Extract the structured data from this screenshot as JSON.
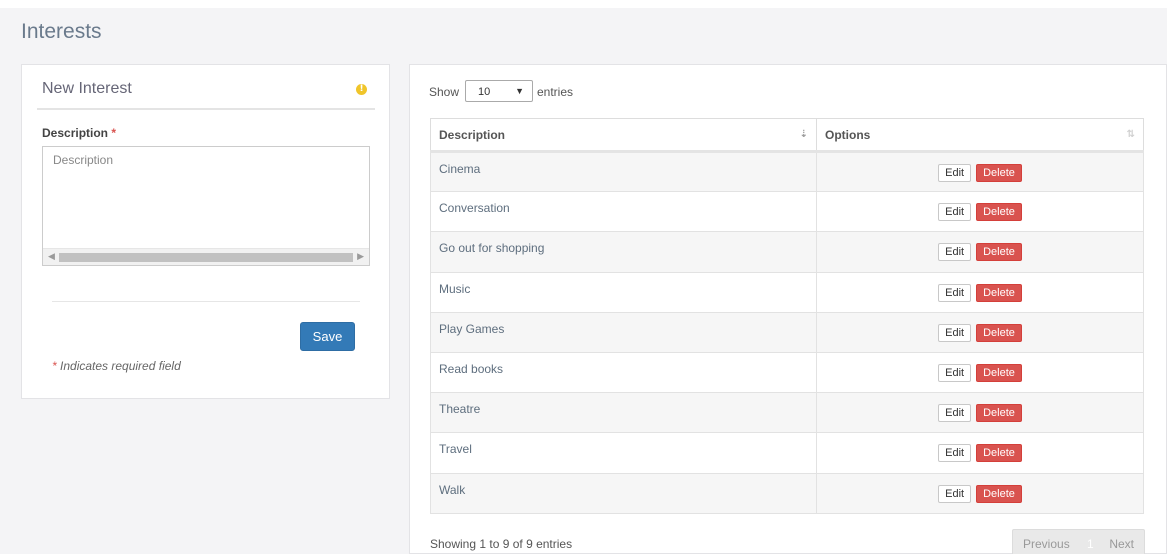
{
  "page": {
    "title": "Interests"
  },
  "form": {
    "panel_title": "New Interest",
    "info_icon": "info-icon",
    "description_label": "Description",
    "required_star": "*",
    "description_placeholder": "Description",
    "save_label": "Save",
    "required_note_star": "*",
    "required_note": " Indicates required field"
  },
  "table": {
    "show_label": "Show",
    "entries_label": "entries",
    "page_length": "10",
    "columns": [
      "Description",
      "Options"
    ],
    "rows": [
      {
        "description": "Cinema",
        "edit": "Edit",
        "delete": "Delete"
      },
      {
        "description": "Conversation",
        "edit": "Edit",
        "delete": "Delete"
      },
      {
        "description": "Go out for shopping",
        "edit": "Edit",
        "delete": "Delete"
      },
      {
        "description": "Music",
        "edit": "Edit",
        "delete": "Delete"
      },
      {
        "description": "Play Games",
        "edit": "Edit",
        "delete": "Delete"
      },
      {
        "description": "Read books",
        "edit": "Edit",
        "delete": "Delete"
      },
      {
        "description": "Theatre",
        "edit": "Edit",
        "delete": "Delete"
      },
      {
        "description": "Travel",
        "edit": "Edit",
        "delete": "Delete"
      },
      {
        "description": "Walk",
        "edit": "Edit",
        "delete": "Delete"
      }
    ],
    "info": "Showing 1 to 9 of 9 entries",
    "pagination": {
      "previous": "Previous",
      "current": "1",
      "next": "Next"
    }
  },
  "colors": {
    "primary": "#337ab7",
    "danger": "#d9534f",
    "warning": "#f0c52a"
  }
}
